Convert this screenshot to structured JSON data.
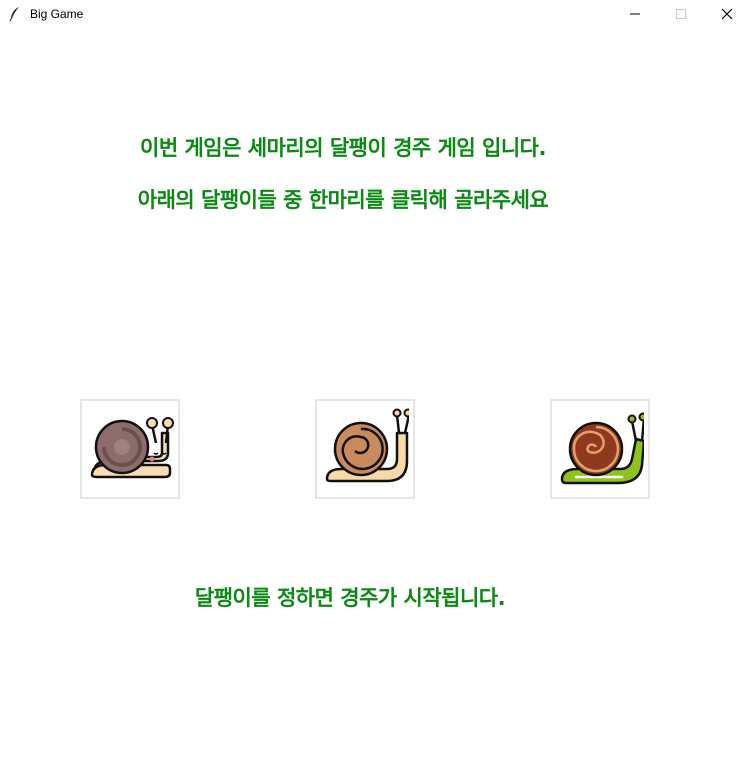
{
  "window": {
    "title": "Big Game",
    "app_icon": "feather-icon",
    "controls": [
      "minimize-icon",
      "maximize-icon",
      "close-icon"
    ]
  },
  "messages": {
    "intro": "이번 게임은 세마리의 달팽이 경주 게임 입니다.",
    "instruction": "아래의 달팽이들 중 한마리를 클릭해 골라주세요",
    "footer": "달팽이를 정하면 경주가 시작됩니다."
  },
  "snails": [
    {
      "icon": "snail-pink-icon"
    },
    {
      "icon": "snail-brown-icon"
    },
    {
      "icon": "snail-green-icon"
    }
  ],
  "colors": {
    "text": "#0a8a12",
    "button_border": "#e6e6e6",
    "background": "#ffffff"
  }
}
